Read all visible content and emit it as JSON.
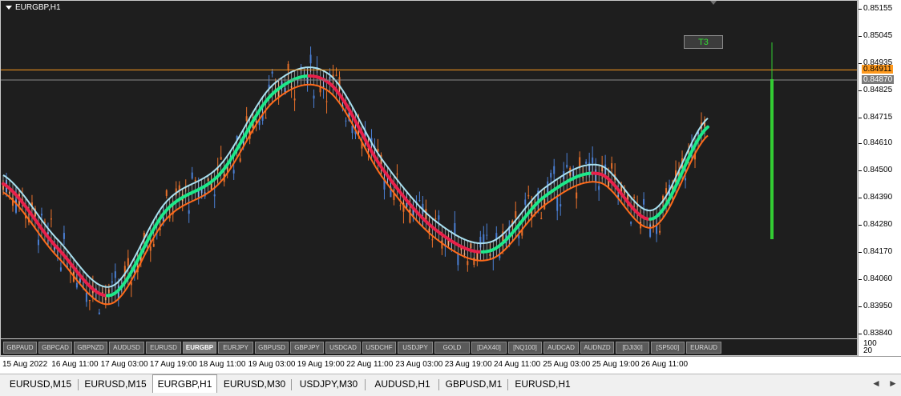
{
  "chart": {
    "title": "EURGBP,H1",
    "signal_label": "T3"
  },
  "price_axis": {
    "labels": [
      {
        "value": 0.85155,
        "text": "0.85155"
      },
      {
        "value": 0.85045,
        "text": "0.85045"
      },
      {
        "value": 0.84935,
        "text": "0.84935"
      },
      {
        "value": 0.84825,
        "text": "0.84825"
      },
      {
        "value": 0.84715,
        "text": "0.84715"
      },
      {
        "value": 0.8461,
        "text": "0.84610"
      },
      {
        "value": 0.845,
        "text": "0.84500"
      },
      {
        "value": 0.8439,
        "text": "0.84390"
      },
      {
        "value": 0.8428,
        "text": "0.84280"
      },
      {
        "value": 0.8417,
        "text": "0.84170"
      },
      {
        "value": 0.8406,
        "text": "0.84060"
      },
      {
        "value": 0.8395,
        "text": "0.83950"
      },
      {
        "value": 0.8384,
        "text": "0.83840"
      }
    ],
    "current_price": {
      "value": 0.84911,
      "text": "0.84911",
      "bg": "#ff9a1e"
    },
    "secondary_price": {
      "value": 0.8487,
      "text": "0.84870",
      "bg": "#7a7a7a"
    }
  },
  "volume_axis": {
    "high": "100",
    "low": "20"
  },
  "time_axis": {
    "labels": [
      "15 Aug 2022",
      "16 Aug 11:00",
      "17 Aug 03:00",
      "17 Aug 19:00",
      "18 Aug 11:00",
      "19 Aug 03:00",
      "19 Aug 19:00",
      "22 Aug 11:00",
      "23 Aug 03:00",
      "23 Aug 19:00",
      "24 Aug 11:00",
      "25 Aug 03:00",
      "25 Aug 19:00",
      "26 Aug 11:00"
    ]
  },
  "symbol_buttons": [
    {
      "label": "GBPAUD",
      "active": false
    },
    {
      "label": "GBPCAD",
      "active": false
    },
    {
      "label": "GBPNZD",
      "active": false
    },
    {
      "label": "AUDUSD",
      "active": false
    },
    {
      "label": "EURUSD",
      "active": false
    },
    {
      "label": "EURGBP",
      "active": true
    },
    {
      "label": "EURJPY",
      "active": false
    },
    {
      "label": "GBPUSD",
      "active": false
    },
    {
      "label": "GBPJPY",
      "active": false
    },
    {
      "label": "USDCAD",
      "active": false
    },
    {
      "label": "USDCHF",
      "active": false
    },
    {
      "label": "USDJPY",
      "active": false
    },
    {
      "label": "GOLD",
      "active": false
    },
    {
      "label": "[DAX40]",
      "active": false
    },
    {
      "label": "[NQ100]",
      "active": false
    },
    {
      "label": "AUDCAD",
      "active": false
    },
    {
      "label": "AUDNZD",
      "active": false
    },
    {
      "label": "[DJI30]",
      "active": false
    },
    {
      "label": "[SP500]",
      "active": false
    },
    {
      "label": "EURAUD",
      "active": false
    }
  ],
  "tabs": [
    {
      "label": "EURUSD,M15",
      "active": false
    },
    {
      "label": "EURUSD,M15",
      "active": false
    },
    {
      "label": "EURGBP,H1",
      "active": true
    },
    {
      "label": "EURUSD,M30",
      "active": false
    },
    {
      "label": "USDJPY,M30",
      "active": false
    },
    {
      "label": "AUDUSD,H1",
      "active": false
    },
    {
      "label": "GBPUSD,M1",
      "active": false
    },
    {
      "label": "EURUSD,H1",
      "active": false
    }
  ],
  "tab_arrows": {
    "left": "◄",
    "right": "►"
  },
  "colors": {
    "background": "#1e1e1e",
    "bull_candle": "#4a7fd4",
    "bear_candle": "#e8702a",
    "upper_band": "#a8e0f0",
    "lower_band": "#ff6a1a",
    "mid_up": "#1de88a",
    "mid_down": "#e8204a",
    "price_line": "#ff9a1e",
    "signal_bar": "#33cc33"
  },
  "chart_data": {
    "type": "line",
    "ylim": [
      0.83795,
      0.85185
    ],
    "series": [
      {
        "role": "midline",
        "values": [
          {
            "time": "15 Aug 2022",
            "price": 0.8445
          },
          {
            "time": "16 Aug 11:00",
            "price": 0.8419
          },
          {
            "time": "17 Aug 03:00",
            "price": 0.84
          },
          {
            "time": "17 Aug 19:00",
            "price": 0.8434
          },
          {
            "time": "18 Aug 11:00",
            "price": 0.8449
          },
          {
            "time": "19 Aug 03:00",
            "price": 0.8482
          },
          {
            "time": "19 Aug 19:00",
            "price": 0.8486
          },
          {
            "time": "22 Aug 11:00",
            "price": 0.8451
          },
          {
            "time": "23 Aug 03:00",
            "price": 0.8426
          },
          {
            "time": "23 Aug 19:00",
            "price": 0.8418
          },
          {
            "time": "24 Aug 11:00",
            "price": 0.844
          },
          {
            "time": "25 Aug 03:00",
            "price": 0.8449
          },
          {
            "time": "25 Aug 19:00",
            "price": 0.8431
          },
          {
            "time": "26 Aug 11:00",
            "price": 0.8468
          }
        ]
      }
    ]
  }
}
